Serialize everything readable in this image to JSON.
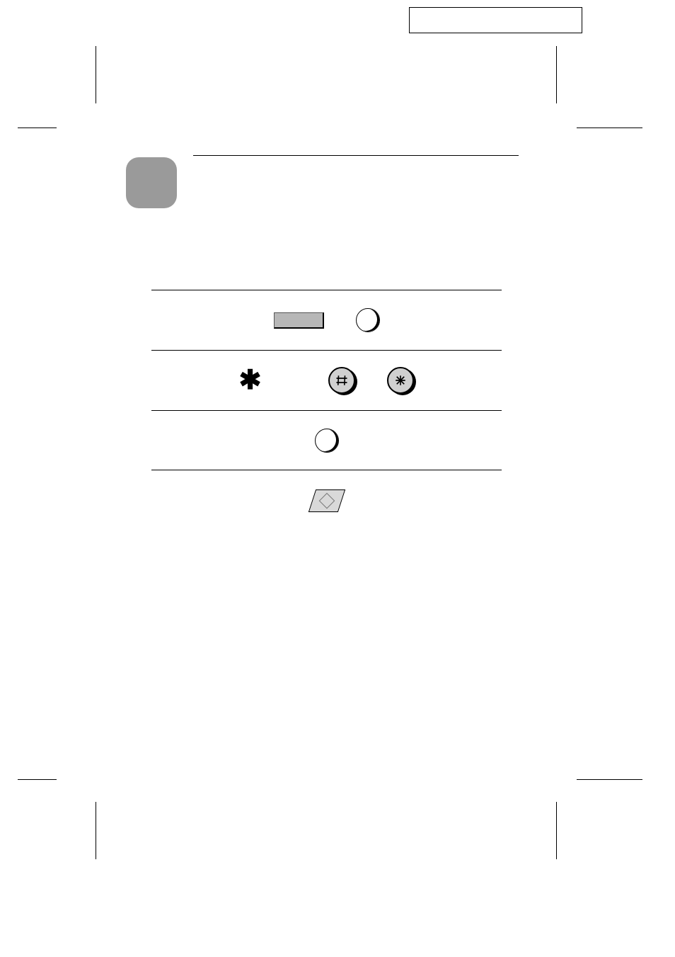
{
  "header": {
    "model_text": ""
  },
  "section": {
    "number_label": "",
    "title": ""
  },
  "table": {
    "rows": [
      {
        "id": "row1",
        "icons": [
          "wide-button",
          "soft-key"
        ]
      },
      {
        "id": "row2",
        "icons": [
          "asterisk-glyph",
          "hash-key",
          "star-key"
        ]
      },
      {
        "id": "row3",
        "icons": [
          "soft-key"
        ]
      },
      {
        "id": "row4",
        "icons": [
          "start-key"
        ]
      }
    ]
  },
  "icons": {
    "hash": "#",
    "star": "✱"
  }
}
